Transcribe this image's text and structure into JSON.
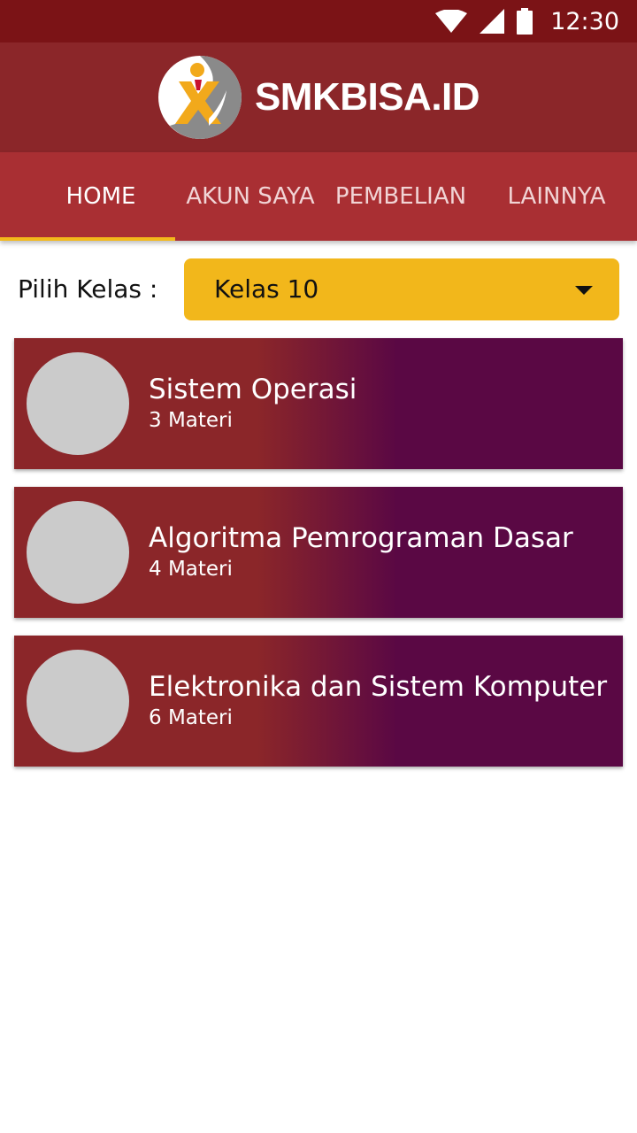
{
  "status_bar": {
    "time": "12:30",
    "icons": [
      "wifi-icon",
      "cellular-signal-icon",
      "battery-icon"
    ]
  },
  "app_bar": {
    "brand": "SMKBISA.ID",
    "logo": "smkbisa-logo"
  },
  "tabs": [
    {
      "label": "HOME",
      "active": true
    },
    {
      "label": "AKUN SAYA",
      "active": false
    },
    {
      "label": "PEMBELIAN",
      "active": false
    },
    {
      "label": "LAINNYA",
      "active": false
    }
  ],
  "class_picker": {
    "label": "Pilih Kelas :",
    "selected": "Kelas 10",
    "icon": "dropdown-arrow-icon"
  },
  "courses": [
    {
      "title": "Sistem Operasi",
      "subtitle": "3 Materi"
    },
    {
      "title": "Algoritma Pemrograman Dasar",
      "subtitle": "4 Materi"
    },
    {
      "title": "Elektronika dan Sistem Komputer",
      "subtitle": "6 Materi"
    }
  ],
  "colors": {
    "status_bar": "#7b1316",
    "app_bar": "#8b2629",
    "tab_bar": "#a92f33",
    "accent": "#f2b71b",
    "card_start": "#8b2629",
    "card_end": "#5a0844",
    "avatar_placeholder": "#cbcbcb"
  }
}
